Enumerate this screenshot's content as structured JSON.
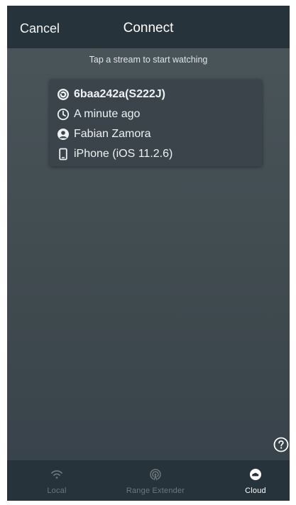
{
  "header": {
    "cancel_label": "Cancel",
    "title": "Connect"
  },
  "instructions": "Tap a stream to start watching",
  "stream": {
    "id": "6baa242a(S222J)",
    "time": "A minute ago",
    "user": "Fabian Zamora",
    "device": "iPhone (iOS 11.2.6)"
  },
  "tabs": [
    {
      "label": "Local",
      "icon": "wifi-icon",
      "active": false
    },
    {
      "label": "Range Extender",
      "icon": "antenna-icon",
      "active": false
    },
    {
      "label": "Cloud",
      "icon": "cloud-icon",
      "active": true
    }
  ],
  "colors": {
    "header_bg": "#27333a",
    "body_bg": "#46515a",
    "active_tab": "#ffffff",
    "inactive_tab": "#6d777c"
  }
}
